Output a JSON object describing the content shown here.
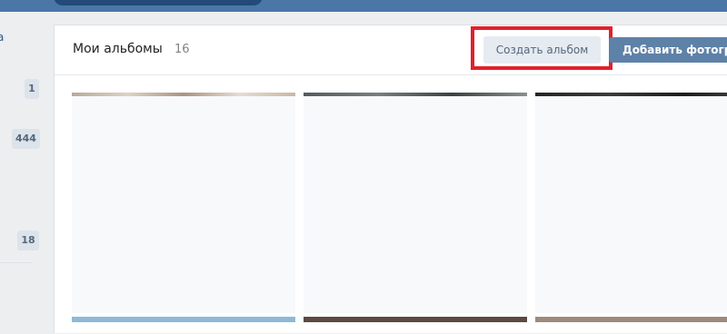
{
  "left_nav": {
    "partial_text": "а",
    "counters": [
      "1",
      "444",
      "18"
    ]
  },
  "albums_panel": {
    "title": "Мои альбомы",
    "count": "16",
    "create_album_label": "Создать альбом",
    "add_photos_label": "Добавить фотограф"
  },
  "colors": {
    "header": "#4a76a8",
    "primary_button": "#5e81a8",
    "secondary_button": "#e5ebf1",
    "highlight": "#e0212b"
  }
}
